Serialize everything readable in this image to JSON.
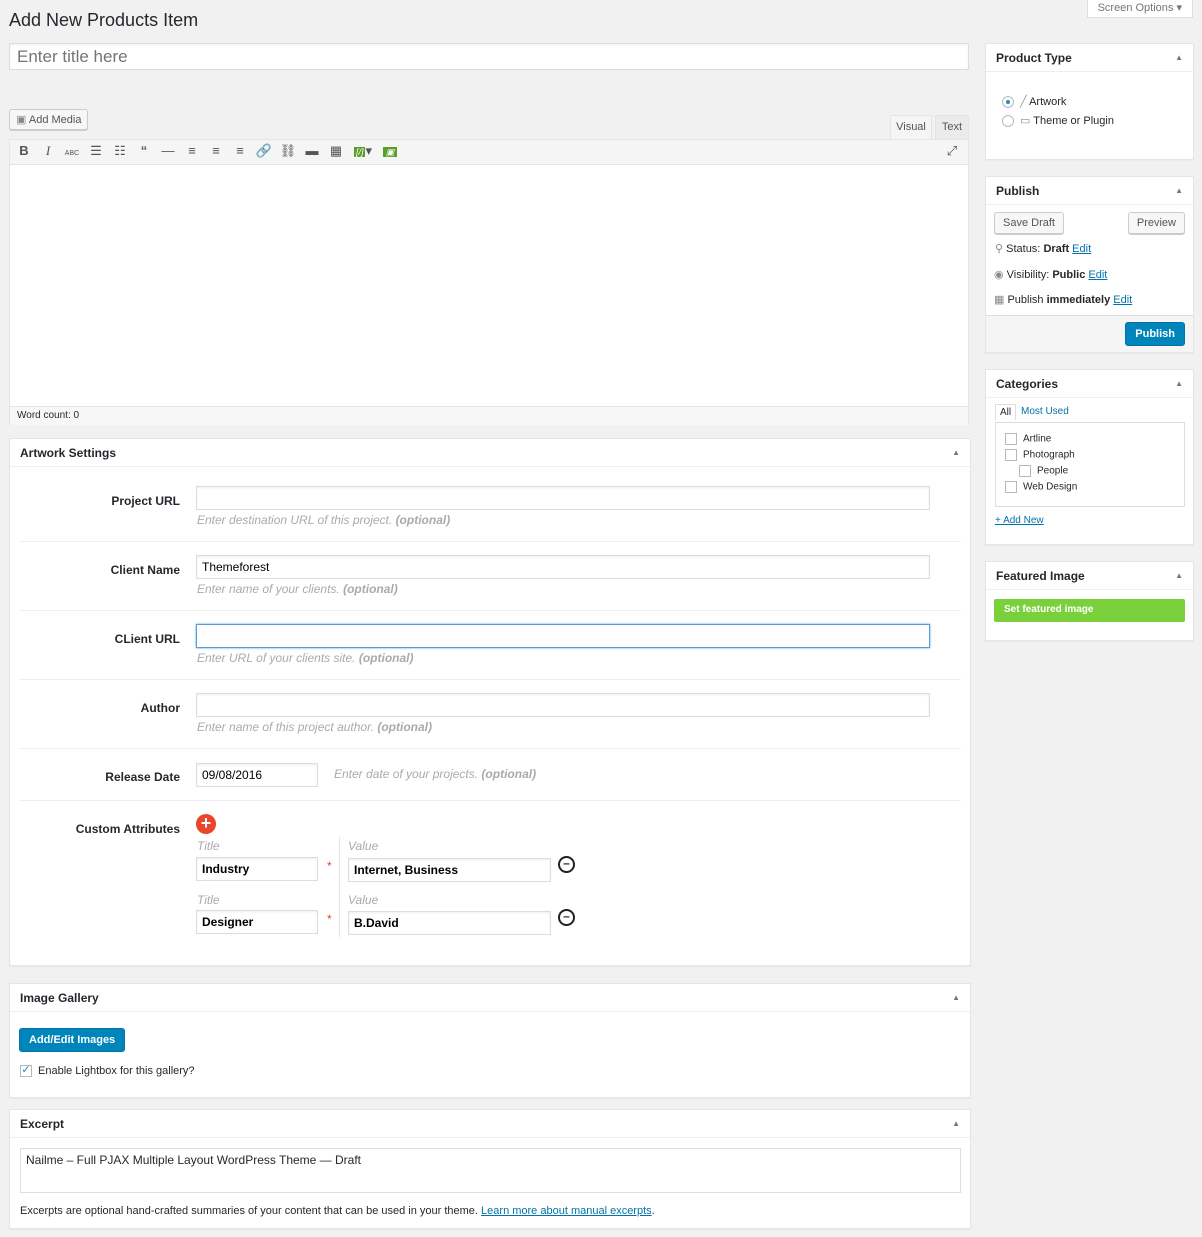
{
  "screen_options": "Screen Options",
  "page_title": "Add New Products Item",
  "title_placeholder": "Enter title here",
  "editor": {
    "add_media": "Add Media",
    "tab_visual": "Visual",
    "tab_text": "Text",
    "word_count": "Word count: 0",
    "toolbar": [
      "bold-icon",
      "italic-icon",
      "strikethrough-icon",
      "bullet-list-icon",
      "numbered-list-icon",
      "blockquote-icon",
      "horizontal-line-icon",
      "align-left-icon",
      "align-center-icon",
      "align-right-icon",
      "link-icon",
      "unlink-icon",
      "read-more-icon",
      "toolbar-toggle-icon",
      "shortcode-icon",
      "image-icon",
      "fullscreen-icon"
    ]
  },
  "artwork": {
    "title": "Artwork Settings",
    "project_url": {
      "label": "Project URL",
      "value": "",
      "hint": "Enter destination URL of this project.",
      "opt": "(optional)"
    },
    "client_name": {
      "label": "Client Name",
      "value": "Themeforest",
      "hint": "Enter name of your clients.",
      "opt": "(optional)"
    },
    "client_url": {
      "label": "CLient URL",
      "value": "",
      "hint": "Enter URL of your clients site.",
      "opt": "(optional)"
    },
    "author": {
      "label": "Author",
      "value": "",
      "hint": "Enter name of this project author.",
      "opt": "(optional)"
    },
    "release_date": {
      "label": "Release Date",
      "value": "09/08/2016",
      "hint": "Enter date of your projects.",
      "opt": "(optional)"
    },
    "custom": {
      "label": "Custom Attributes",
      "title_label": "Title",
      "value_label": "Value",
      "required": "*",
      "rows": [
        {
          "title": "Industry",
          "value": "Internet, Business"
        },
        {
          "title": "Designer",
          "value": "B.David"
        }
      ]
    }
  },
  "gallery": {
    "title": "Image Gallery",
    "button": "Add/Edit Images",
    "lightbox": "Enable Lightbox for this gallery?",
    "lightbox_checked": true
  },
  "excerpt": {
    "title": "Excerpt",
    "value": "Nailme – Full PJAX Multiple Layout WordPress Theme — Draft",
    "note": "Excerpts are optional hand-crafted summaries of your content that can be used in your theme.",
    "link": "Learn more about manual excerpts",
    "period": "."
  },
  "product_type": {
    "title": "Product Type",
    "options": [
      {
        "label": "Artwork",
        "selected": true
      },
      {
        "label": "Theme or Plugin",
        "selected": false
      }
    ]
  },
  "publish": {
    "title": "Publish",
    "save_draft": "Save Draft",
    "preview": "Preview",
    "status_label": "Status:",
    "status": "Draft",
    "visibility_label": "Visibility:",
    "visibility": "Public",
    "publish_label": "Publish",
    "publish_when": "immediately",
    "edit": "Edit",
    "publish_button": "Publish"
  },
  "categories": {
    "title": "Categories",
    "tab_all": "All",
    "tab_most_used": "Most Used",
    "items": [
      "Artline",
      "Photograph",
      "People",
      "Web Design"
    ],
    "add_new": "+ Add New"
  },
  "featured": {
    "title": "Featured Image",
    "button": "Set featured image"
  },
  "colors": {
    "primary": "#0085ba",
    "featured": "#7ad03a",
    "add_attr": "#e9462c"
  }
}
